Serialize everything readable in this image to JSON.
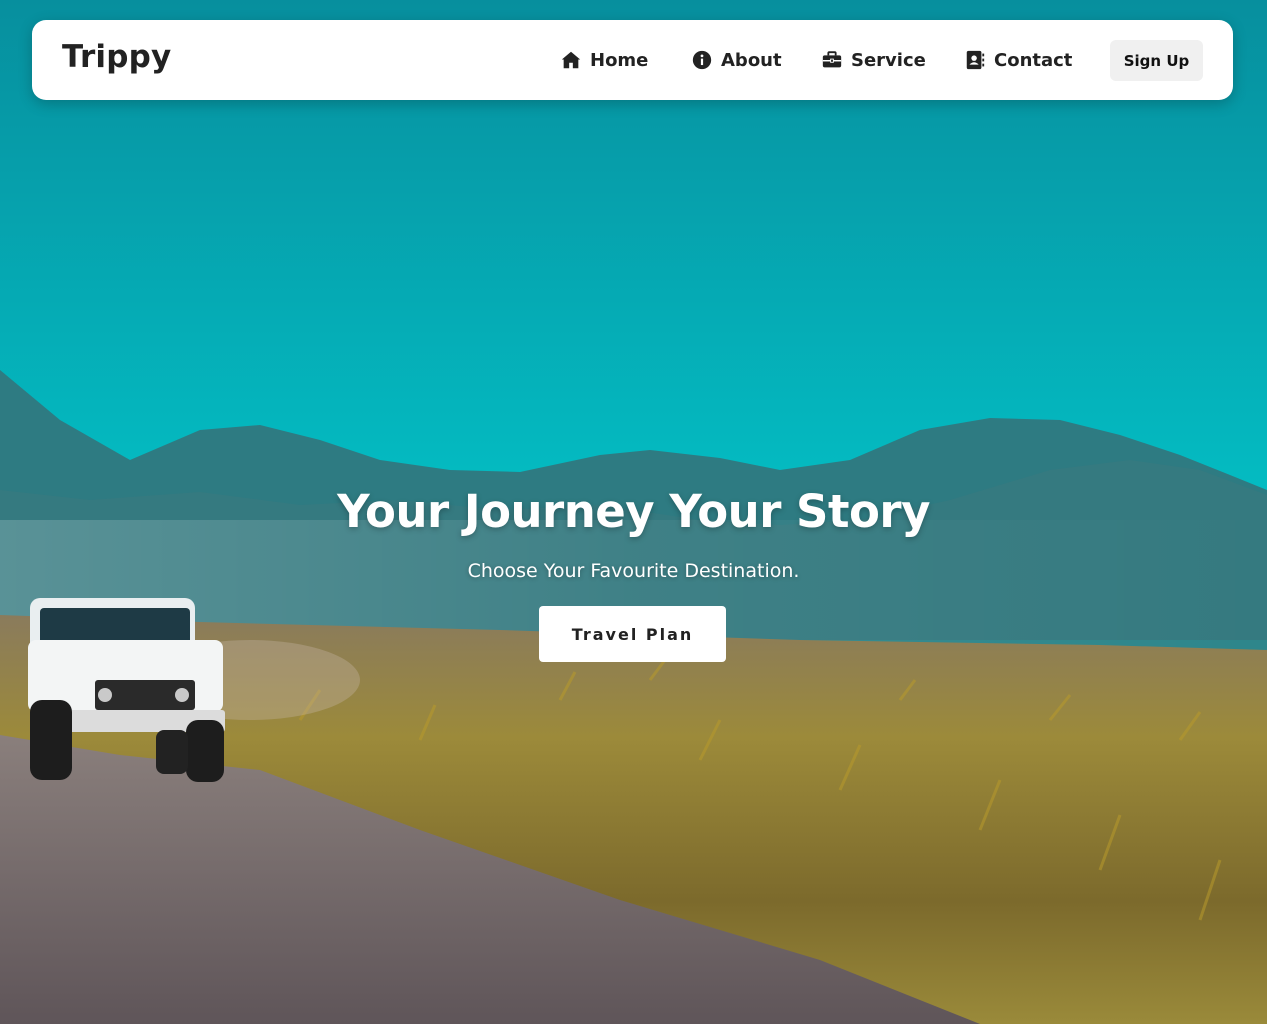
{
  "brand": {
    "name": "Trippy"
  },
  "nav": {
    "items": [
      {
        "label": "Home",
        "icon": "home-icon"
      },
      {
        "label": "About",
        "icon": "info-icon"
      },
      {
        "label": "Service",
        "icon": "briefcase-icon"
      },
      {
        "label": "Contact",
        "icon": "contact-book-icon"
      }
    ],
    "signup_label": "Sign Up"
  },
  "hero": {
    "title": "Your Journey Your Story",
    "subtitle": "Choose Your Favourite Destination.",
    "cta_label": "Travel Plan"
  },
  "colors": {
    "sky_top": "#07909F",
    "sky_horizon": "#00DCD8",
    "mountains": "#2F7F86",
    "field": "#8A7A3C",
    "road": "#6E6468",
    "text_dark": "#222222"
  }
}
